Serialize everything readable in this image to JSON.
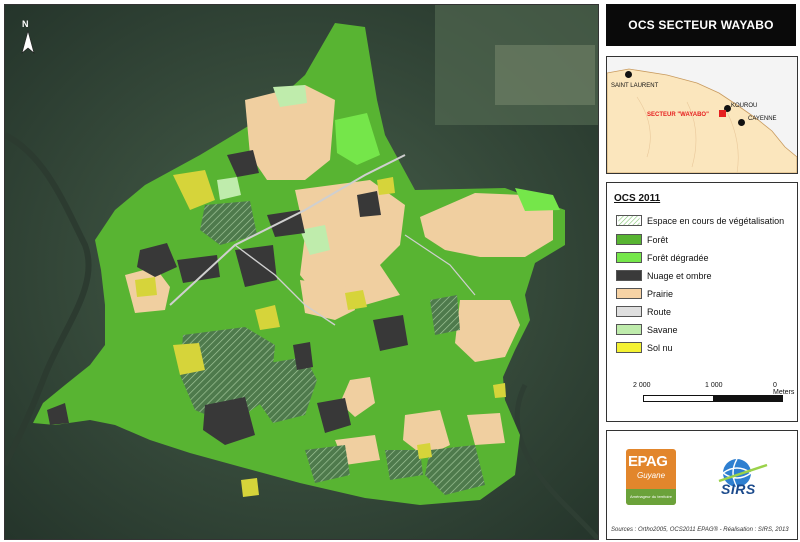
{
  "map": {
    "north_letter": "N",
    "classes_in_view": [
      "Forêt",
      "Prairie",
      "Nuage et ombre",
      "Sol nu",
      "Espace en cours de végétalisation",
      "Route",
      "Savane",
      "Forêt dégradée"
    ]
  },
  "title": "OCS SECTEUR WAYABO",
  "locator": {
    "cities": [
      {
        "name": "SAINT LAURENT"
      },
      {
        "name": "KOUROU"
      },
      {
        "name": "CAYENNE"
      }
    ],
    "sector_label": "SECTEUR \"WAYABO\"",
    "colors": {
      "land": "#fbe6bd",
      "sea": "#f4f4f4",
      "sector": "#e62020"
    }
  },
  "legend": {
    "title": "OCS 2011",
    "items": [
      {
        "label": "Espace en cours de végétalisation",
        "color": "#b8e3a2",
        "pattern": "hatched"
      },
      {
        "label": "Forêt",
        "color": "#58b432"
      },
      {
        "label": "Forêt dégradée",
        "color": "#75e64a"
      },
      {
        "label": "Nuage et ombre",
        "color": "#3a3a3a"
      },
      {
        "label": "Prairie",
        "color": "#f7d3a5"
      },
      {
        "label": "Route",
        "color": "#dfdfdf"
      },
      {
        "label": "Savane",
        "color": "#bfecac"
      },
      {
        "label": "Sol nu",
        "color": "#f4f233"
      }
    ]
  },
  "scale": {
    "labels": [
      "2 000",
      "1 000",
      "0 Meters"
    ]
  },
  "logos": {
    "epag_main": "EPAG",
    "epag_sub": "Guyane",
    "epag_bottom": "Aménageur du territoire",
    "sirs": "SIRS"
  },
  "sources": "Sources : Ortho2005, OCS2011 EPAG® - Réalisation : SIRS, 2013"
}
